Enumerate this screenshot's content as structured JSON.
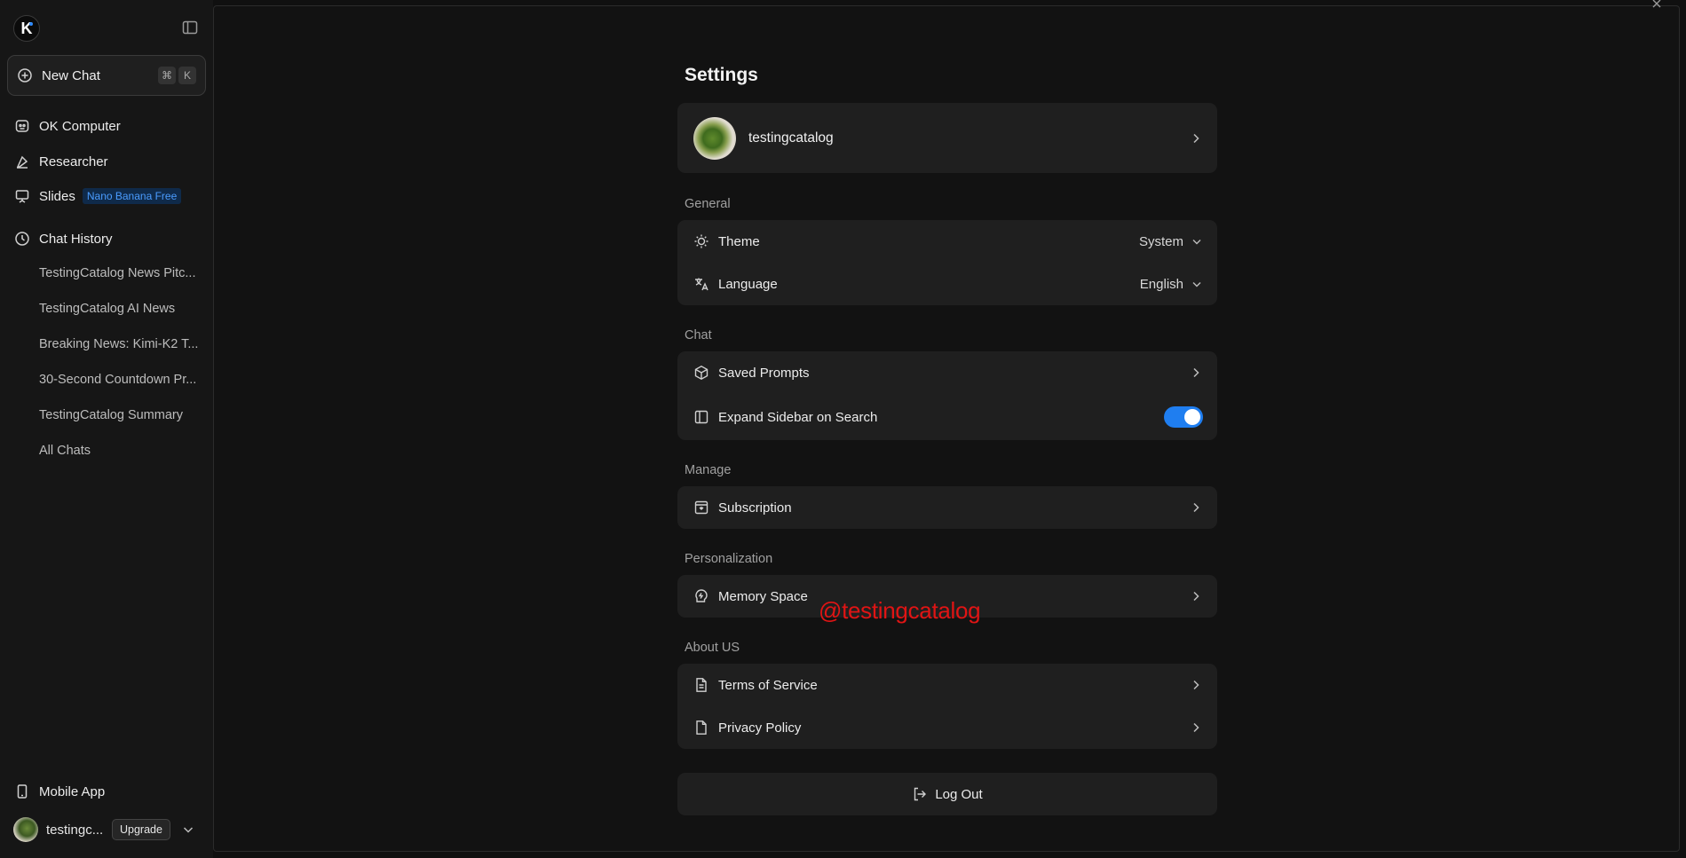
{
  "sidebar": {
    "logo_letter": "K",
    "new_chat": {
      "label": "New Chat",
      "shortcut": [
        "⌘",
        "K"
      ]
    },
    "nav": [
      {
        "label": "OK Computer",
        "icon": "robot-icon"
      },
      {
        "label": "Researcher",
        "icon": "flask-icon"
      },
      {
        "label": "Slides",
        "icon": "presentation-icon",
        "badge": "Nano Banana Free"
      }
    ],
    "history": {
      "label": "Chat History",
      "items": [
        "TestingCatalog News Pitc...",
        "TestingCatalog AI News",
        "Breaking News: Kimi-K2 T...",
        "30-Second Countdown Pr...",
        "TestingCatalog Summary",
        "All Chats"
      ]
    },
    "mobile_app": "Mobile App",
    "user": {
      "name": "testingc...",
      "upgrade": "Upgrade"
    }
  },
  "settings": {
    "title": "Settings",
    "profile": {
      "name": "testingcatalog"
    },
    "sections": {
      "general": "General",
      "chat": "Chat",
      "manage": "Manage",
      "personalization": "Personalization",
      "about": "About US"
    },
    "theme": {
      "label": "Theme",
      "value": "System"
    },
    "language": {
      "label": "Language",
      "value": "English"
    },
    "saved_prompts": "Saved Prompts",
    "expand_sidebar": {
      "label": "Expand Sidebar on Search",
      "enabled": true
    },
    "subscription": "Subscription",
    "memory_space": "Memory Space",
    "terms": "Terms of Service",
    "privacy": "Privacy Policy",
    "logout": "Log Out"
  },
  "watermark": "@testingcatalog",
  "colors": {
    "accent": "#1f7ef0",
    "badge_text": "#4a9cff",
    "watermark": "#e01414"
  }
}
